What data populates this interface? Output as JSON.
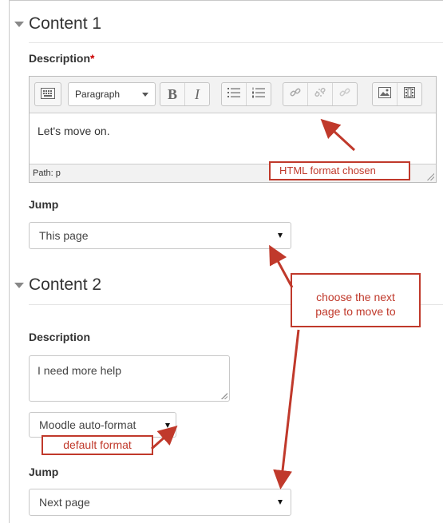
{
  "content1": {
    "heading": "Content 1",
    "description_label": "Description",
    "required_mark": "*",
    "editor": {
      "paragraph_select": "Paragraph",
      "bold": "B",
      "italic": "I",
      "body_text": "Let's move on.",
      "path_text": "Path: p"
    },
    "jump_label": "Jump",
    "jump_value": "This page"
  },
  "content2": {
    "heading": "Content 2",
    "description_label": "Description",
    "description_text": "I need more help",
    "format_value": "Moodle auto-format",
    "jump_label": "Jump",
    "jump_value": "Next page"
  },
  "annotations": {
    "html_format": "HTML format chosen",
    "next_page_line1": "choose the next",
    "next_page_line2": "page to move to",
    "default_format": "default format"
  },
  "colors": {
    "annotation": "#c0392b",
    "required": "#cc0000"
  }
}
